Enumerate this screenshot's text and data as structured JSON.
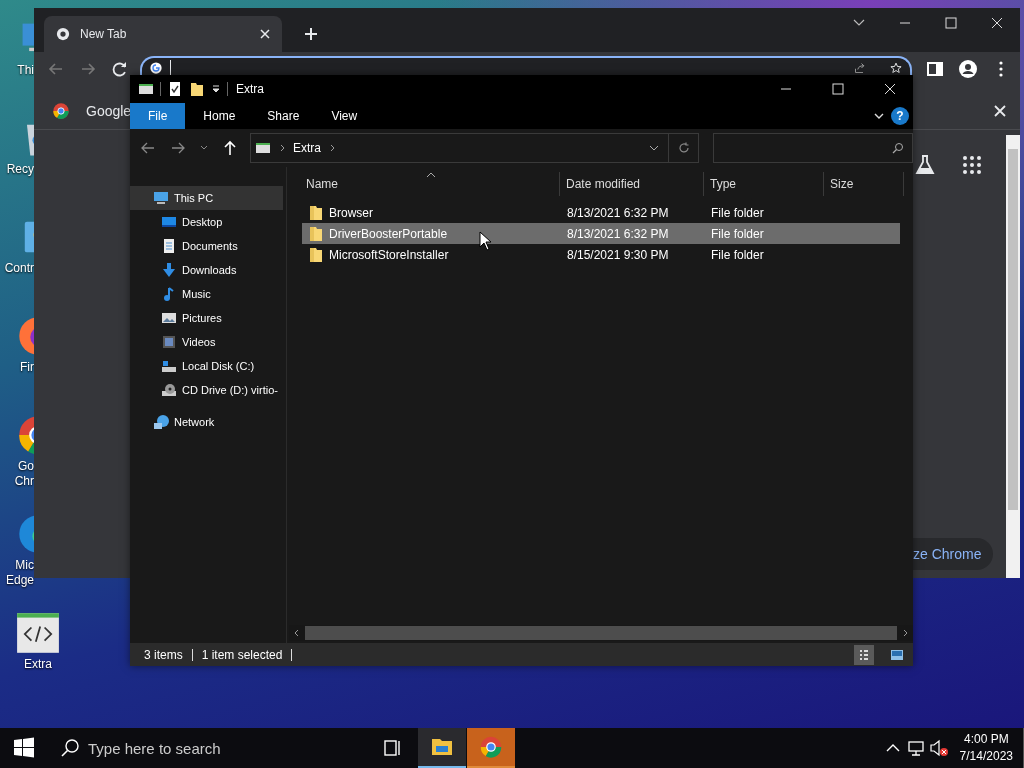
{
  "desktop": {
    "icons": [
      {
        "kind": "pc",
        "lines": [
          "Thi"
        ]
      },
      {
        "kind": "recycle",
        "lines": [
          "Recy"
        ]
      },
      {
        "kind": "control",
        "lines": [
          "Contr"
        ]
      },
      {
        "kind": "firefox",
        "lines": [
          "Fir"
        ]
      },
      {
        "kind": "chrome",
        "lines": [
          "Go",
          "Chr"
        ]
      },
      {
        "kind": "edge",
        "lines": [
          "Mic",
          "Edge"
        ]
      },
      {
        "kind": "code",
        "lines": [
          "Extra"
        ]
      }
    ]
  },
  "chrome": {
    "tab": {
      "title": "New Tab"
    },
    "infobar": {
      "text": "Google"
    },
    "customize_button": {
      "label": "ze Chrome"
    }
  },
  "explorer": {
    "title": "Extra",
    "ribbon_tabs": [
      {
        "label": "File",
        "kind": "menu"
      },
      {
        "label": "Home",
        "kind": "tab"
      },
      {
        "label": "Share",
        "kind": "tab"
      },
      {
        "label": "View",
        "kind": "tab"
      }
    ],
    "help": "?",
    "breadcrumb": [
      "Extra"
    ],
    "nav": [
      {
        "label": "This PC",
        "kind": "pc",
        "selected": true,
        "children": [
          {
            "label": "Desktop",
            "kind": "desktop",
            "selected": false
          },
          {
            "label": "Documents",
            "kind": "documents",
            "selected": false
          },
          {
            "label": "Downloads",
            "kind": "downloads",
            "selected": false
          },
          {
            "label": "Music",
            "kind": "music",
            "selected": false
          },
          {
            "label": "Pictures",
            "kind": "pictures",
            "selected": false
          },
          {
            "label": "Videos",
            "kind": "videos",
            "selected": false
          },
          {
            "label": "Local Disk (C:)",
            "kind": "disk",
            "selected": false
          },
          {
            "label": "CD Drive (D:) virtio-",
            "kind": "cd",
            "selected": false
          }
        ]
      },
      {
        "label": "Network",
        "kind": "network",
        "selected": false
      }
    ],
    "columns": [
      {
        "label": "Name",
        "sorted": true
      },
      {
        "label": "Date modified",
        "sorted": false
      },
      {
        "label": "Type",
        "sorted": false
      },
      {
        "label": "Size",
        "sorted": false
      }
    ],
    "rows": [
      {
        "name": "Browser",
        "date": "8/13/2021 6:32 PM",
        "type": "File folder",
        "selected": false
      },
      {
        "name": "DriverBoosterPortable",
        "date": "8/13/2021 6:32 PM",
        "type": "File folder",
        "selected": true
      },
      {
        "name": "MicrosoftStoreInstaller",
        "date": "8/15/2021 9:30 PM",
        "type": "File folder",
        "selected": false
      }
    ],
    "status": {
      "count": "3 items",
      "selection": "1 item selected"
    },
    "view_buttons": [
      {
        "kind": "details",
        "selected": true
      },
      {
        "kind": "preview",
        "selected": false
      }
    ]
  },
  "taskbar": {
    "search": {
      "placeholder": "Type here to search"
    },
    "apps": [
      {
        "kind": "explorer",
        "active": true,
        "flashing": false
      },
      {
        "kind": "chrome",
        "active": false,
        "flashing": true
      }
    ],
    "time": "4:00 PM",
    "date": "7/14/2023"
  }
}
